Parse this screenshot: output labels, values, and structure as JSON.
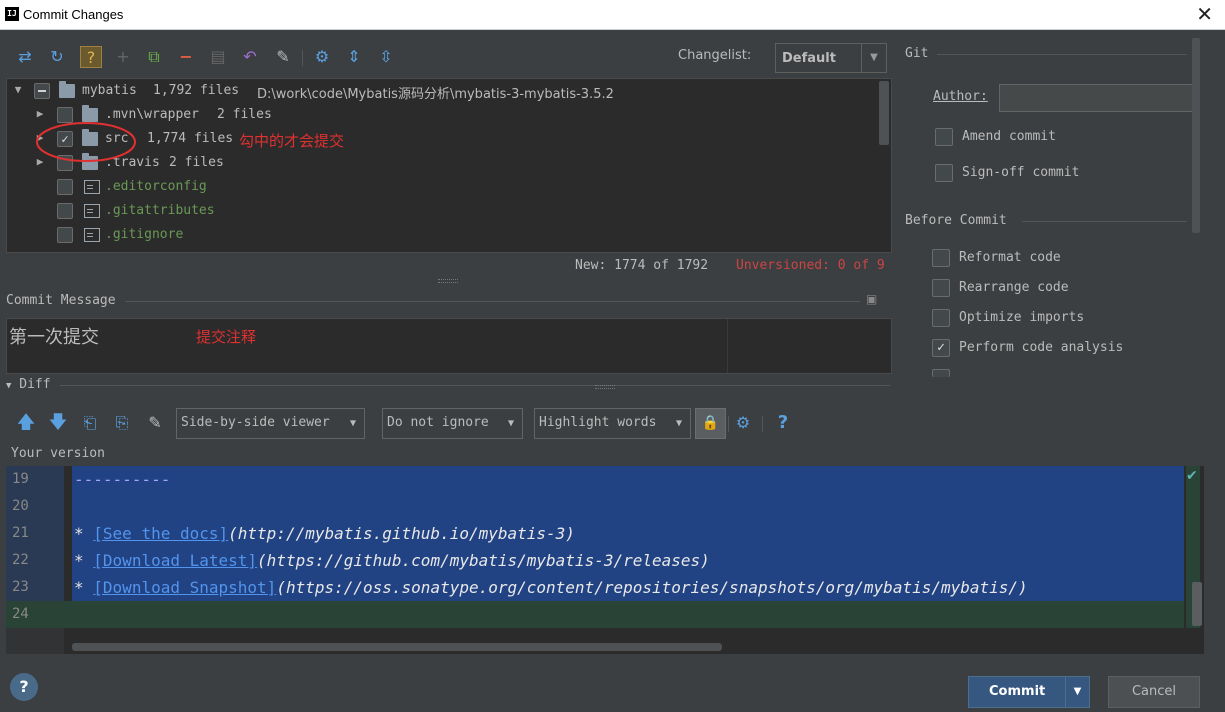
{
  "window": {
    "title": "Commit Changes",
    "icon_text": "IJ"
  },
  "toolbar": {
    "changelist_label": "Changelist:",
    "changelist_value": "Default"
  },
  "tree": {
    "root": {
      "name": "mybatis",
      "count": "1,792 files",
      "path": "D:\\work\\code\\Mybatis源码分析\\mybatis-3-mybatis-3.5.2"
    },
    "rows": [
      {
        "name": ".mvn\\wrapper",
        "count": "2 files"
      },
      {
        "name": "src",
        "count": "1,774 files"
      },
      {
        "name": ".travis",
        "count": "2 files"
      },
      {
        "name": ".editorconfig"
      },
      {
        "name": ".gitattributes"
      },
      {
        "name": ".gitignore"
      }
    ],
    "annotation_checked": "勾中的才会提交"
  },
  "stats": {
    "new": "New: 1774 of 1792",
    "unversioned": "Unversioned: 0 of 9"
  },
  "commit_message": {
    "label": "Commit Message",
    "text": "第一次提交",
    "annotation": "提交注释"
  },
  "git_panel": {
    "title": "Git",
    "author_label": "Author:",
    "author_value": "",
    "amend": "Amend commit",
    "signoff": "Sign-off commit",
    "before_commit": "Before Commit",
    "reformat": "Reformat code",
    "rearrange": "Rearrange code",
    "optimize": "Optimize imports",
    "perform": "Perform code analysis"
  },
  "diff": {
    "title": "Diff",
    "viewer": "Side-by-side viewer",
    "ignore": "Do not ignore",
    "highlight": "Highlight words",
    "your_version": "Your version",
    "lines": [
      {
        "num": "19",
        "dash": "----------"
      },
      {
        "num": "20"
      },
      {
        "num": "21",
        "link": "[See the docs]",
        "url": "(http://mybatis.github.io/mybatis-3)"
      },
      {
        "num": "22",
        "link": "[Download Latest]",
        "url": "(https://github.com/mybatis/mybatis-3/releases)"
      },
      {
        "num": "23",
        "link": "[Download Snapshot]",
        "url": "(https://oss.sonatype.org/content/repositories/snapshots/org/mybatis/mybatis/)"
      },
      {
        "num": "24"
      }
    ],
    "bullet": "*"
  },
  "buttons": {
    "help": "?",
    "commit": "Commit",
    "cancel": "Cancel"
  },
  "colors": {
    "accent": "#365880",
    "annotation": "#e03030",
    "unversioned": "#cc4444",
    "new": "#6a9955"
  }
}
